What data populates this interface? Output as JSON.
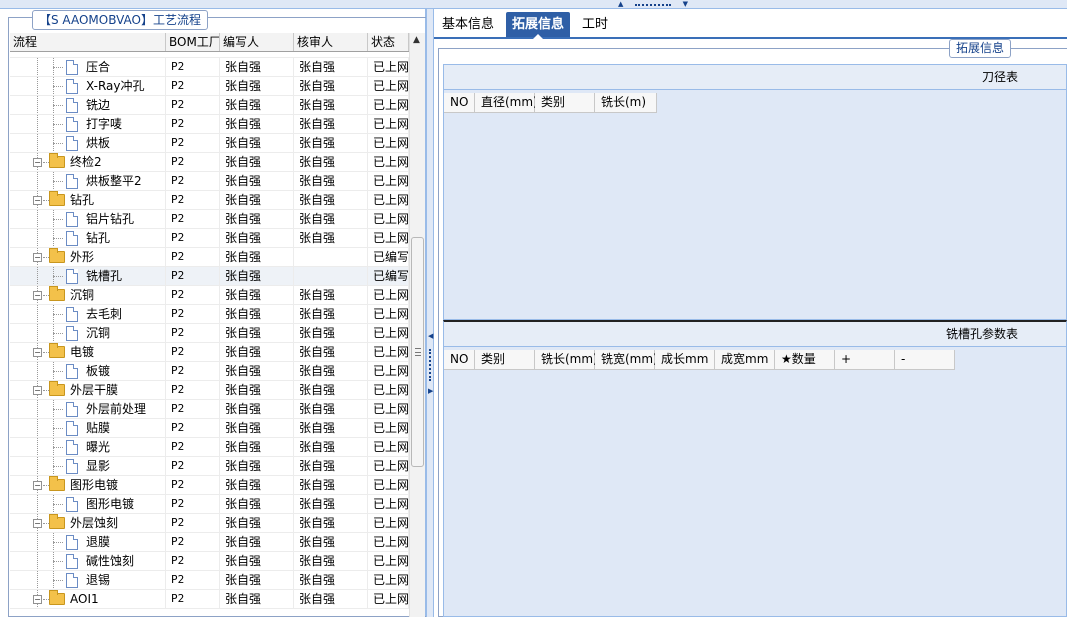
{
  "left_panel": {
    "title": "【S AAOMOBVAO】工艺流程",
    "columns": [
      "流程",
      "BOM工厂",
      "编写人",
      "核审人",
      "状态"
    ],
    "rows": [
      {
        "name": "压合",
        "kind": "doc",
        "bom": "P2",
        "writer": "张自强",
        "reviewer": "张自强",
        "status": "已上网"
      },
      {
        "name": "X-Ray冲孔",
        "kind": "doc",
        "bom": "P2",
        "writer": "张自强",
        "reviewer": "张自强",
        "status": "已上网"
      },
      {
        "name": "铣边",
        "kind": "doc",
        "bom": "P2",
        "writer": "张自强",
        "reviewer": "张自强",
        "status": "已上网"
      },
      {
        "name": "打字唛",
        "kind": "doc",
        "bom": "P2",
        "writer": "张自强",
        "reviewer": "张自强",
        "status": "已上网"
      },
      {
        "name": "烘板",
        "kind": "doc",
        "bom": "P2",
        "writer": "张自强",
        "reviewer": "张自强",
        "status": "已上网"
      },
      {
        "name": "终检2",
        "kind": "folder",
        "bom": "P2",
        "writer": "张自强",
        "reviewer": "张自强",
        "status": "已上网"
      },
      {
        "name": "烘板整平2",
        "kind": "doc",
        "bom": "P2",
        "writer": "张自强",
        "reviewer": "张自强",
        "status": "已上网"
      },
      {
        "name": "钻孔",
        "kind": "folder",
        "bom": "P2",
        "writer": "张自强",
        "reviewer": "张自强",
        "status": "已上网"
      },
      {
        "name": "铝片钻孔",
        "kind": "doc",
        "bom": "P2",
        "writer": "张自强",
        "reviewer": "张自强",
        "status": "已上网"
      },
      {
        "name": "钻孔",
        "kind": "doc",
        "bom": "P2",
        "writer": "张自强",
        "reviewer": "张自强",
        "status": "已上网"
      },
      {
        "name": "外形",
        "kind": "folder",
        "bom": "P2",
        "writer": "张自强",
        "reviewer": "",
        "status": "已编写"
      },
      {
        "name": "铣槽孔",
        "kind": "doc",
        "bom": "P2",
        "writer": "张自强",
        "reviewer": "",
        "status": "已编写",
        "selected": true
      },
      {
        "name": "沉铜",
        "kind": "folder",
        "bom": "P2",
        "writer": "张自强",
        "reviewer": "张自强",
        "status": "已上网"
      },
      {
        "name": "去毛刺",
        "kind": "doc",
        "bom": "P2",
        "writer": "张自强",
        "reviewer": "张自强",
        "status": "已上网"
      },
      {
        "name": "沉铜",
        "kind": "doc",
        "bom": "P2",
        "writer": "张自强",
        "reviewer": "张自强",
        "status": "已上网"
      },
      {
        "name": "电镀",
        "kind": "folder",
        "bom": "P2",
        "writer": "张自强",
        "reviewer": "张自强",
        "status": "已上网"
      },
      {
        "name": "板镀",
        "kind": "doc",
        "bom": "P2",
        "writer": "张自强",
        "reviewer": "张自强",
        "status": "已上网"
      },
      {
        "name": "外层干膜",
        "kind": "folder",
        "bom": "P2",
        "writer": "张自强",
        "reviewer": "张自强",
        "status": "已上网"
      },
      {
        "name": "外层前处理",
        "kind": "doc",
        "bom": "P2",
        "writer": "张自强",
        "reviewer": "张自强",
        "status": "已上网"
      },
      {
        "name": "贴膜",
        "kind": "doc",
        "bom": "P2",
        "writer": "张自强",
        "reviewer": "张自强",
        "status": "已上网"
      },
      {
        "name": "曝光",
        "kind": "doc",
        "bom": "P2",
        "writer": "张自强",
        "reviewer": "张自强",
        "status": "已上网"
      },
      {
        "name": "显影",
        "kind": "doc",
        "bom": "P2",
        "writer": "张自强",
        "reviewer": "张自强",
        "status": "已上网"
      },
      {
        "name": "图形电镀",
        "kind": "folder",
        "bom": "P2",
        "writer": "张自强",
        "reviewer": "张自强",
        "status": "已上网"
      },
      {
        "name": "图形电镀",
        "kind": "doc",
        "bom": "P2",
        "writer": "张自强",
        "reviewer": "张自强",
        "status": "已上网"
      },
      {
        "name": "外层蚀刻",
        "kind": "folder",
        "bom": "P2",
        "writer": "张自强",
        "reviewer": "张自强",
        "status": "已上网"
      },
      {
        "name": "退膜",
        "kind": "doc",
        "bom": "P2",
        "writer": "张自强",
        "reviewer": "张自强",
        "status": "已上网"
      },
      {
        "name": "碱性蚀刻",
        "kind": "doc",
        "bom": "P2",
        "writer": "张自强",
        "reviewer": "张自强",
        "status": "已上网"
      },
      {
        "name": "退锡",
        "kind": "doc",
        "bom": "P2",
        "writer": "张自强",
        "reviewer": "张自强",
        "status": "已上网"
      },
      {
        "name": "AOI1",
        "kind": "folder",
        "bom": "P2",
        "writer": "张自强",
        "reviewer": "张自强",
        "status": "已上网"
      }
    ]
  },
  "right_panel": {
    "tabs": [
      {
        "label": "基本信息",
        "active": false
      },
      {
        "label": "拓展信息",
        "active": true
      },
      {
        "label": "工时",
        "active": false
      }
    ],
    "section_title": "拓展信息",
    "table1": {
      "title": "刀径表",
      "columns": [
        "NO",
        "直径(mm)",
        "类别",
        "铣长(m)"
      ]
    },
    "table2": {
      "title": "铣槽孔参数表",
      "columns": [
        "NO",
        "类别",
        "铣长(mm)",
        "铣宽(mm)",
        "成长mm",
        "成宽mm",
        "★数量",
        "+",
        "-"
      ]
    }
  }
}
